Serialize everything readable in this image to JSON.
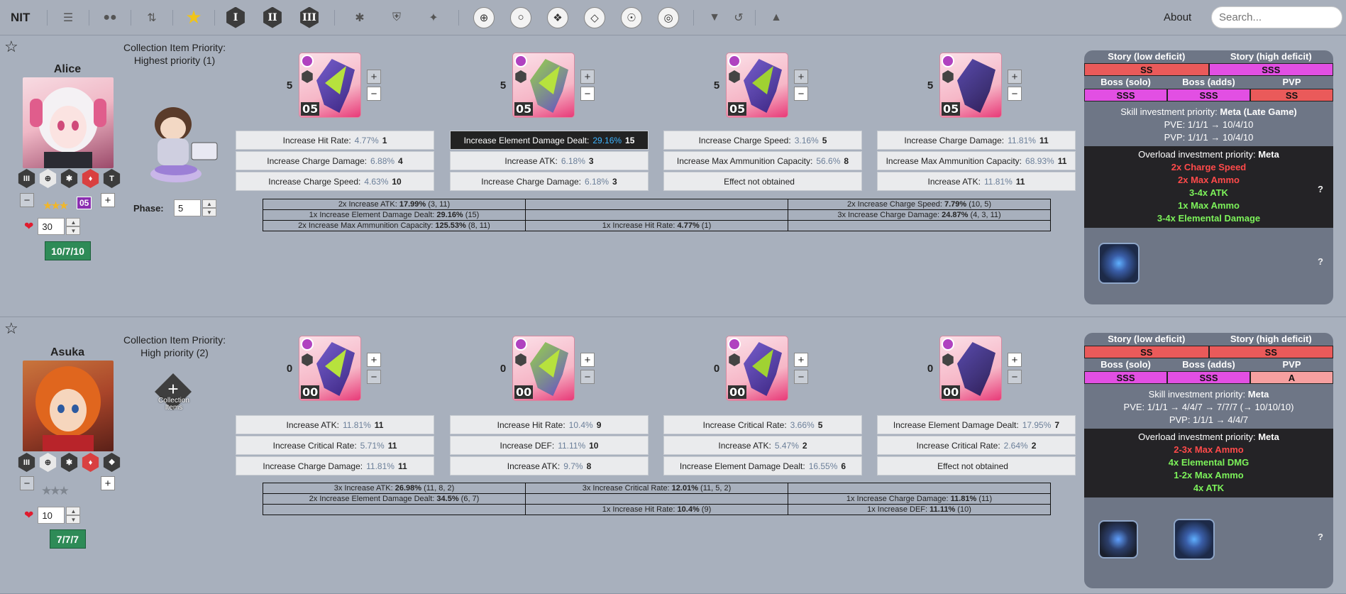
{
  "app": {
    "title": "NIT",
    "about": "About",
    "search_placeholder": "Search..."
  },
  "toolbar": {
    "icons": [
      "filters-icon",
      "group-icon",
      "sort-icon",
      "favorite-star-icon",
      "burst-1-icon",
      "burst-2-icon",
      "burst-3-icon",
      "attacker-class-icon",
      "defender-class-icon",
      "supporter-class-icon",
      "ar-weapon-icon",
      "smg-weapon-icon",
      "sg-weapon-icon",
      "rl-weapon-icon",
      "sr-weapon-icon",
      "mg-weapon-icon",
      "funnel-icon",
      "reset-icon",
      "graduation-cap-icon"
    ],
    "burst_labels": [
      "I",
      "II",
      "III"
    ]
  },
  "characters": [
    {
      "name": "Alice",
      "collection_title": "Collection Item Priority:",
      "collection_priority": "Highest priority (1)",
      "collection_label": "",
      "phase_label": "Phase:",
      "phase_value": "5",
      "level_value": "30",
      "skills_badge": "10/7/10",
      "star_count": "3",
      "limit_badge": "05",
      "icon_row": [
        "III",
        "crosshair",
        "attacker",
        "fire",
        "T"
      ],
      "gear": [
        {
          "count": "5",
          "level": "05",
          "stats": [
            {
              "name": "Increase Hit Rate:",
              "pct": "4.77%",
              "lv": "1",
              "dark": false
            },
            {
              "name": "Increase Charge Damage:",
              "pct": "6.88%",
              "lv": "4",
              "dark": false
            },
            {
              "name": "Increase Charge Speed:",
              "pct": "4.63%",
              "lv": "10",
              "dark": false
            }
          ]
        },
        {
          "count": "5",
          "level": "05",
          "stats": [
            {
              "name": "Increase Element Damage Dealt:",
              "pct": "29.16%",
              "lv": "15",
              "dark": true
            },
            {
              "name": "Increase ATK:",
              "pct": "6.18%",
              "lv": "3",
              "dark": false
            },
            {
              "name": "Increase Charge Damage:",
              "pct": "6.18%",
              "lv": "3",
              "dark": false
            }
          ]
        },
        {
          "count": "5",
          "level": "05",
          "stats": [
            {
              "name": "Increase Charge Speed:",
              "pct": "3.16%",
              "lv": "5",
              "dark": false
            },
            {
              "name": "Increase Max Ammunition Capacity:",
              "pct": "56.6%",
              "lv": "8",
              "dark": false
            },
            {
              "name": "Effect not obtained",
              "pct": "",
              "lv": "",
              "dark": false
            }
          ]
        },
        {
          "count": "5",
          "level": "05",
          "stats": [
            {
              "name": "Increase Charge Damage:",
              "pct": "11.81%",
              "lv": "11",
              "dark": false
            },
            {
              "name": "Increase Max Ammunition Capacity:",
              "pct": "68.93%",
              "lv": "11",
              "dark": false
            },
            {
              "name": "Increase ATK:",
              "pct": "11.81%",
              "lv": "11",
              "dark": false
            }
          ]
        }
      ],
      "summary": [
        [
          {
            "pre": "2x Increase ATK: ",
            "val": "17.99%",
            "post": " (3, 11)"
          },
          {
            "pre": "",
            "val": "",
            "post": ""
          },
          {
            "pre": "2x Increase Charge Speed: ",
            "val": "7.79%",
            "post": " (10, 5)"
          }
        ],
        [
          {
            "pre": "1x Increase Element Damage Dealt: ",
            "val": "29.16%",
            "post": " (15)"
          },
          {
            "pre": "",
            "val": "",
            "post": ""
          },
          {
            "pre": "3x Increase Charge Damage: ",
            "val": "24.87%",
            "post": " (4, 3, 11)"
          }
        ],
        [
          {
            "pre": "2x Increase Max Ammunition Capacity: ",
            "val": "125.53%",
            "post": " (8, 11)"
          },
          {
            "pre": "1x Increase Hit Rate: ",
            "val": "4.77%",
            "post": " (1)"
          },
          {
            "pre": "",
            "val": "",
            "post": ""
          }
        ]
      ],
      "ratings": {
        "headers2": [
          "Story (low deficit)",
          "Story (high deficit)"
        ],
        "values2": [
          {
            "v": "SS",
            "c": "#ea5a5a"
          },
          {
            "v": "SSS",
            "c": "#e24fe3"
          }
        ],
        "headers3": [
          "Boss (solo)",
          "Boss (adds)",
          "PVP"
        ],
        "values3": [
          {
            "v": "SSS",
            "c": "#e24fe3"
          },
          {
            "v": "SSS",
            "c": "#e24fe3"
          },
          {
            "v": "SS",
            "c": "#ea5a5a"
          }
        ]
      },
      "skill_priority_label": "Skill investment priority:",
      "skill_priority": "Meta (Late Game)",
      "pve": "PVE: 1/1/1 → 10/4/10",
      "pvp": "PVP: 1/1/1 → 10/4/10",
      "overload_label": "Overload investment priority:",
      "overload_priority": "Meta",
      "overload_lines": [
        {
          "t": "2x Charge Speed",
          "c": "#ff4a4a"
        },
        {
          "t": "2x Max Ammo",
          "c": "#ff4a4a"
        },
        {
          "t": "3-4x ATK",
          "c": "#7cf25a"
        },
        {
          "t": "1x Max Ammo",
          "c": "#7cf25a"
        },
        {
          "t": "3-4x Elemental Damage",
          "c": "#7cf25a"
        }
      ],
      "cube_count": 1,
      "help": "?"
    },
    {
      "name": "Asuka",
      "collection_title": "Collection Item Priority:",
      "collection_priority": "High priority (2)",
      "collection_label": "Collection Items",
      "phase_label": "",
      "phase_value": "",
      "level_value": "10",
      "skills_badge": "7/7/7",
      "star_count": "0",
      "limit_badge": "",
      "icon_row": [
        "III",
        "crosshair",
        "attacker",
        "fire",
        "wind"
      ],
      "gear": [
        {
          "count": "0",
          "level": "00",
          "stats": [
            {
              "name": "Increase ATK:",
              "pct": "11.81%",
              "lv": "11",
              "dark": false
            },
            {
              "name": "Increase Critical Rate:",
              "pct": "5.71%",
              "lv": "11",
              "dark": false
            },
            {
              "name": "Increase Charge Damage:",
              "pct": "11.81%",
              "lv": "11",
              "dark": false
            }
          ]
        },
        {
          "count": "0",
          "level": "00",
          "stats": [
            {
              "name": "Increase Hit Rate:",
              "pct": "10.4%",
              "lv": "9",
              "dark": false
            },
            {
              "name": "Increase DEF:",
              "pct": "11.11%",
              "lv": "10",
              "dark": false
            },
            {
              "name": "Increase ATK:",
              "pct": "9.7%",
              "lv": "8",
              "dark": false
            }
          ]
        },
        {
          "count": "0",
          "level": "00",
          "stats": [
            {
              "name": "Increase Critical Rate:",
              "pct": "3.66%",
              "lv": "5",
              "dark": false
            },
            {
              "name": "Increase ATK:",
              "pct": "5.47%",
              "lv": "2",
              "dark": false
            },
            {
              "name": "Increase Element Damage Dealt:",
              "pct": "16.55%",
              "lv": "6",
              "dark": false
            }
          ]
        },
        {
          "count": "0",
          "level": "00",
          "stats": [
            {
              "name": "Increase Element Damage Dealt:",
              "pct": "17.95%",
              "lv": "7",
              "dark": false
            },
            {
              "name": "Increase Critical Rate:",
              "pct": "2.64%",
              "lv": "2",
              "dark": false
            },
            {
              "name": "Effect not obtained",
              "pct": "",
              "lv": "",
              "dark": false
            }
          ]
        }
      ],
      "summary": [
        [
          {
            "pre": "3x Increase ATK: ",
            "val": "26.98%",
            "post": " (11, 8, 2)"
          },
          {
            "pre": "3x Increase Critical Rate: ",
            "val": "12.01%",
            "post": " (11, 5, 2)"
          },
          {
            "pre": "",
            "val": "",
            "post": ""
          }
        ],
        [
          {
            "pre": "2x Increase Element Damage Dealt: ",
            "val": "34.5%",
            "post": " (6, 7)"
          },
          {
            "pre": "",
            "val": "",
            "post": ""
          },
          {
            "pre": "1x Increase Charge Damage: ",
            "val": "11.81%",
            "post": " (11)"
          }
        ],
        [
          {
            "pre": "",
            "val": "",
            "post": ""
          },
          {
            "pre": "1x Increase Hit Rate: ",
            "val": "10.4%",
            "post": " (9)"
          },
          {
            "pre": "1x Increase DEF: ",
            "val": "11.11%",
            "post": " (10)"
          }
        ]
      ],
      "ratings": {
        "headers2": [
          "Story (low deficit)",
          "Story (high deficit)"
        ],
        "values2": [
          {
            "v": "SS",
            "c": "#ea5a5a"
          },
          {
            "v": "SS",
            "c": "#ea5a5a"
          }
        ],
        "headers3": [
          "Boss (solo)",
          "Boss (adds)",
          "PVP"
        ],
        "values3": [
          {
            "v": "SSS",
            "c": "#e24fe3"
          },
          {
            "v": "SSS",
            "c": "#e24fe3"
          },
          {
            "v": "A",
            "c": "#f6a0a0"
          }
        ]
      },
      "skill_priority_label": "Skill investment priority:",
      "skill_priority": "Meta",
      "pve": "PVE: 1/1/1 → 4/4/7 → 7/7/7 (→ 10/10/10)",
      "pvp": "PVP: 1/1/1 → 4/4/7",
      "overload_label": "Overload investment priority:",
      "overload_priority": "Meta",
      "overload_lines": [
        {
          "t": "2-3x Max Ammo",
          "c": "#ff4a4a"
        },
        {
          "t": "4x Elemental DMG",
          "c": "#7cf25a"
        },
        {
          "t": "1-2x Max Ammo",
          "c": "#7cf25a"
        },
        {
          "t": "4x ATK",
          "c": "#7cf25a"
        }
      ],
      "cube_count": 2,
      "help": "?"
    }
  ]
}
